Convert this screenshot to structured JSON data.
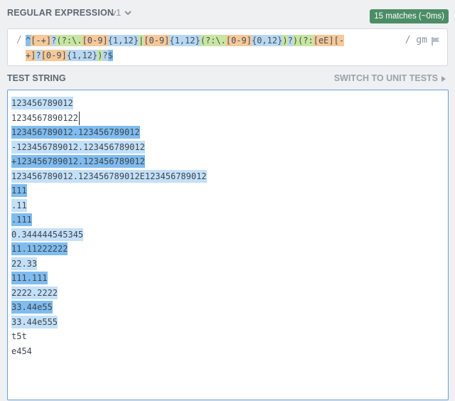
{
  "regex_section": {
    "title": "REGULAR EXPRESSION",
    "version": "v1",
    "match_badge": "15 matches (~0ms)",
    "delimiter_open": "/",
    "delimiter_close_flags": "/ gm",
    "pattern_line1": [
      {
        "t": "^",
        "c": "t-anchor"
      },
      {
        "t": "[-+]",
        "c": "t-set"
      },
      {
        "t": "?",
        "c": "t-qnt"
      },
      {
        "t": "(?:",
        "c": "t-grp"
      },
      {
        "t": "\\.",
        "c": "t-esc"
      },
      {
        "t": "[0-9]",
        "c": "t-set"
      },
      {
        "t": "{1,12}",
        "c": "t-qnt"
      },
      {
        "t": "|",
        "c": "t-alt"
      },
      {
        "t": "[0-9]",
        "c": "t-set"
      },
      {
        "t": "{1,12}",
        "c": "t-qnt"
      },
      {
        "t": "(?:",
        "c": "t-grp"
      },
      {
        "t": "\\.",
        "c": "t-esc"
      },
      {
        "t": "[0-9]",
        "c": "t-set"
      },
      {
        "t": "{0,12}",
        "c": "t-qnt"
      },
      {
        "t": ")",
        "c": "t-grp"
      },
      {
        "t": "?",
        "c": "t-qnt"
      },
      {
        "t": ")",
        "c": "t-grp"
      },
      {
        "t": "(?:",
        "c": "t-grp"
      },
      {
        "t": "[eE]",
        "c": "t-set"
      },
      {
        "t": "[-",
        "c": "t-set"
      }
    ],
    "pattern_line2": [
      {
        "t": "+]",
        "c": "t-set"
      },
      {
        "t": "?",
        "c": "t-qnt"
      },
      {
        "t": "[0-9]",
        "c": "t-set"
      },
      {
        "t": "{1,12}",
        "c": "t-qnt"
      },
      {
        "t": ")",
        "c": "t-grp"
      },
      {
        "t": "?",
        "c": "t-qnt"
      },
      {
        "t": "$",
        "c": "t-anchor"
      }
    ]
  },
  "test_section": {
    "title": "TEST STRING",
    "switch_label": "SWITCH TO UNIT TESTS",
    "lines": [
      {
        "text": "123456789012",
        "hl": "light"
      },
      {
        "text": "1234567890122",
        "hl": "none",
        "caret": true
      },
      {
        "text": "123456789012.123456789012",
        "hl": "dark"
      },
      {
        "text": "-123456789012.123456789012",
        "hl": "light"
      },
      {
        "text": "+123456789012.123456789012",
        "hl": "dark"
      },
      {
        "text": "123456789012.123456789012E123456789012",
        "hl": "light"
      },
      {
        "text": "111",
        "hl": "dark"
      },
      {
        "text": ".11",
        "hl": "light"
      },
      {
        "text": ".111",
        "hl": "dark"
      },
      {
        "text": "0.344444545345",
        "hl": "light"
      },
      {
        "text": "11.11222222",
        "hl": "dark"
      },
      {
        "text": "22.33",
        "hl": "light"
      },
      {
        "text": "111.111",
        "hl": "dark"
      },
      {
        "text": "2222.2222",
        "hl": "light"
      },
      {
        "text": "33.44e55",
        "hl": "dark"
      },
      {
        "text": "33.44e555",
        "hl": "light"
      },
      {
        "text": "t5t",
        "hl": "none"
      },
      {
        "text": "e454",
        "hl": "none"
      }
    ]
  },
  "icons": {
    "version_dropdown": "chevron-down-icon",
    "flag": "flag-icon",
    "switch_arrow": "triangle-right-icon"
  },
  "colors": {
    "badge": "#4c8d66",
    "highlight_dark": "#7fbcf0",
    "highlight_light": "#c3e0f9",
    "token_set": "#f6c99a",
    "token_group": "#c8e6a1",
    "token_anchor": "#86c0ee"
  }
}
